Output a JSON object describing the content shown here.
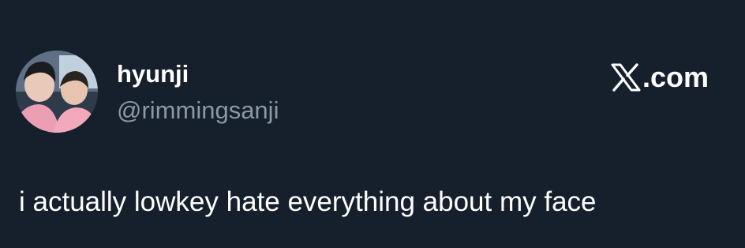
{
  "tweet": {
    "author": {
      "display_name": "hyunji",
      "handle": "@rimmingsanji",
      "avatar": "two-people-photo"
    },
    "brand": {
      "logo_icon": "x-logo-icon",
      "domain": ".com"
    },
    "text": "i actually lowkey hate everything about my face"
  },
  "colors": {
    "background": "#16202c",
    "primary_text": "#ffffff",
    "secondary_text": "#8b98a5"
  }
}
